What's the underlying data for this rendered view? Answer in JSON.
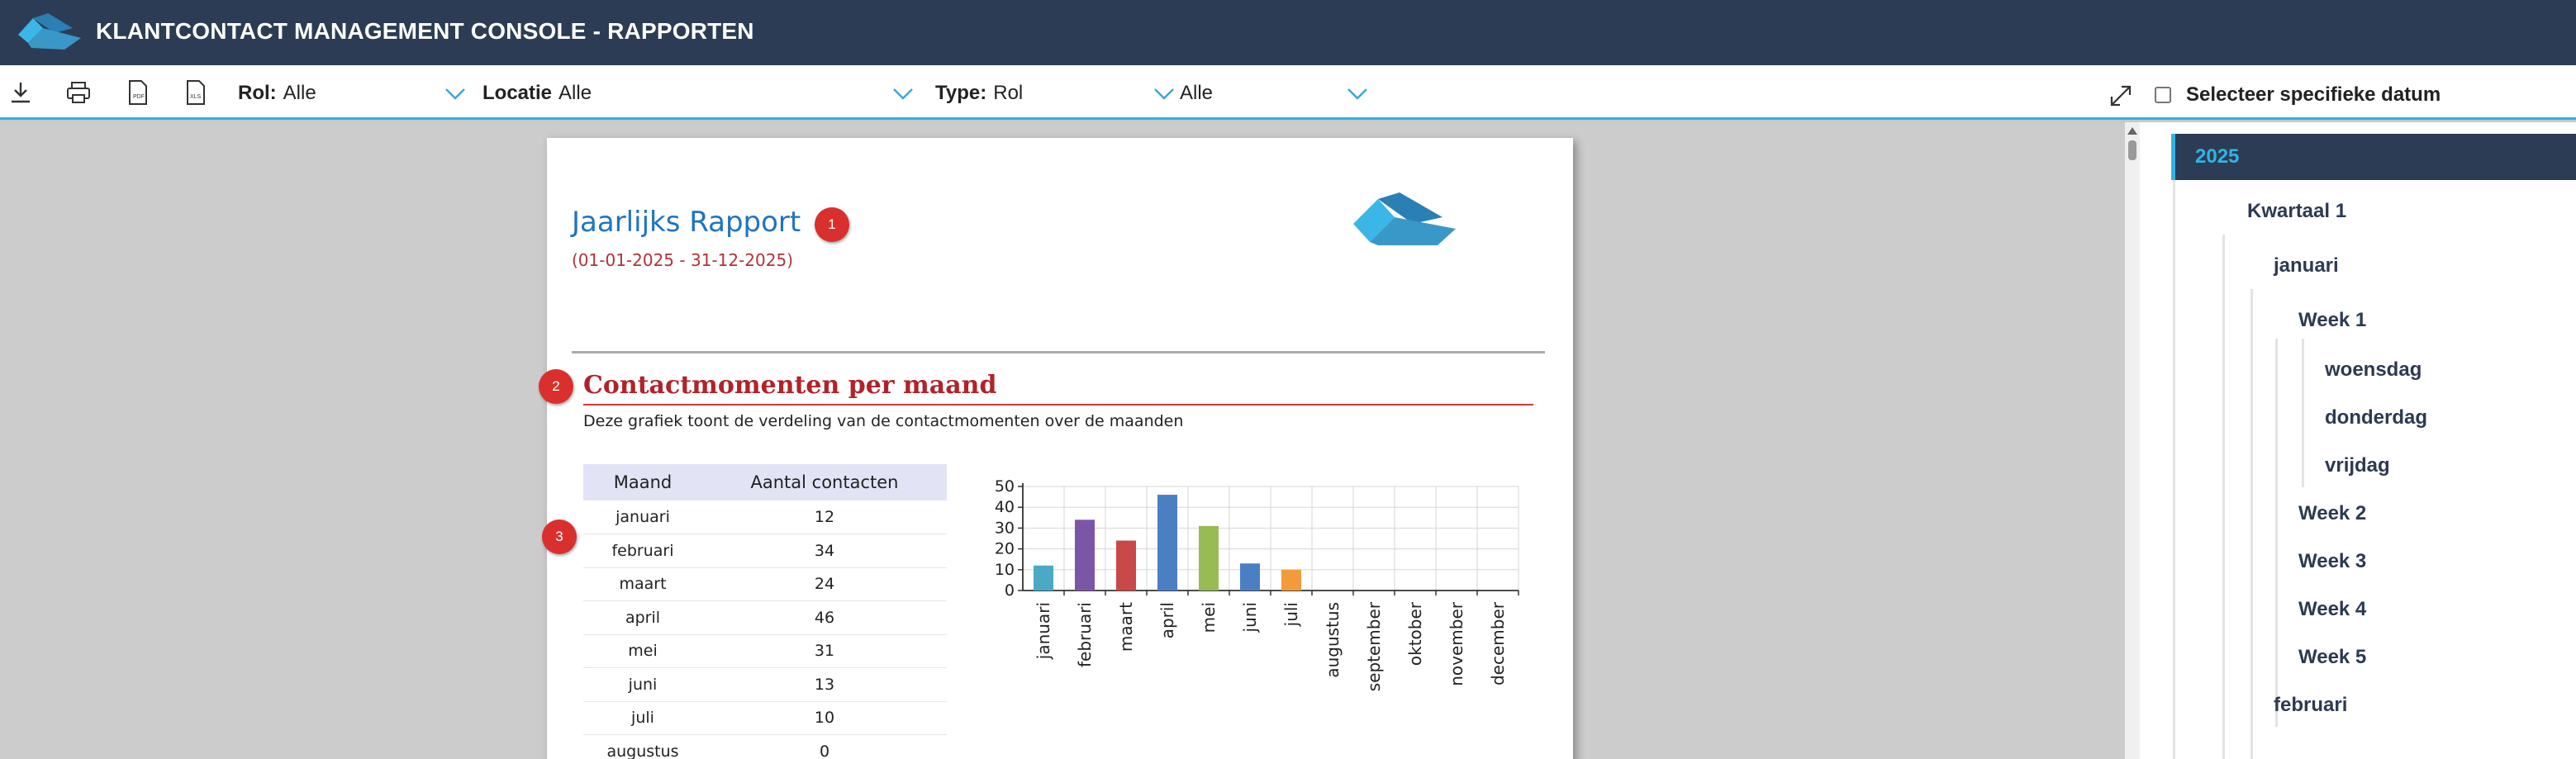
{
  "app": {
    "title": "KLANTCONTACT MANAGEMENT CONSOLE - RAPPORTEN"
  },
  "toolbar": {
    "icons": [
      "download-icon",
      "print-icon",
      "pdf-export-icon",
      "xls-export-icon"
    ],
    "filters": {
      "rol_label": "Rol:",
      "rol_value": "Alle",
      "locatie_label": "Locatie",
      "locatie_value": "Alle",
      "type_label": "Type:",
      "type_value": "Rol",
      "extra_value": "Alle"
    },
    "date_checkbox_label": "Selecteer specifieke datum"
  },
  "report": {
    "title": "Jaarlijks Rapport",
    "range": "(01-01-2025 - 31-12-2025)",
    "badges": [
      "1",
      "2",
      "3"
    ],
    "section_title": "Contactmomenten per maand",
    "section_description": "Deze grafiek toont de verdeling van de contactmomenten over de maanden",
    "table": {
      "headers": [
        "Maand",
        "Aantal contacten"
      ],
      "rows": [
        [
          "januari",
          "12"
        ],
        [
          "februari",
          "34"
        ],
        [
          "maart",
          "24"
        ],
        [
          "april",
          "46"
        ],
        [
          "mei",
          "31"
        ],
        [
          "juni",
          "13"
        ],
        [
          "juli",
          "10"
        ],
        [
          "augustus",
          "0"
        ]
      ]
    }
  },
  "chart_data": {
    "type": "bar",
    "categories": [
      "januari",
      "februari",
      "maart",
      "april",
      "mei",
      "juni",
      "juli",
      "augustus",
      "september",
      "oktober",
      "november",
      "december"
    ],
    "values": [
      12,
      34,
      24,
      46,
      31,
      13,
      10,
      0,
      0,
      0,
      0,
      0
    ],
    "colors": [
      "#4aa9c4",
      "#7c56a6",
      "#c9484a",
      "#4a7fc4",
      "#98bb54",
      "#4a7fc4",
      "#f39a3a",
      "#888888",
      "#888888",
      "#888888",
      "#888888",
      "#888888"
    ],
    "yticks": [
      0,
      10,
      20,
      30,
      40,
      50
    ],
    "ylim": [
      0,
      50
    ],
    "grid": true,
    "title": "",
    "xlabel": "",
    "ylabel": ""
  },
  "tree": {
    "items": [
      {
        "label": "2025",
        "level": 0,
        "selected": true
      },
      {
        "label": "Kwartaal 1",
        "level": 1
      },
      {
        "label": "januari",
        "level": 2
      },
      {
        "label": "Week 1",
        "level": 3
      },
      {
        "label": "woensdag",
        "level": 4
      },
      {
        "label": "donderdag",
        "level": 4
      },
      {
        "label": "vrijdag",
        "level": 4
      },
      {
        "label": "Week 2",
        "level": 3
      },
      {
        "label": "Week 3",
        "level": 3
      },
      {
        "label": "Week 4",
        "level": 3
      },
      {
        "label": "Week 5",
        "level": 3
      },
      {
        "label": "februari",
        "level": 2
      }
    ]
  }
}
